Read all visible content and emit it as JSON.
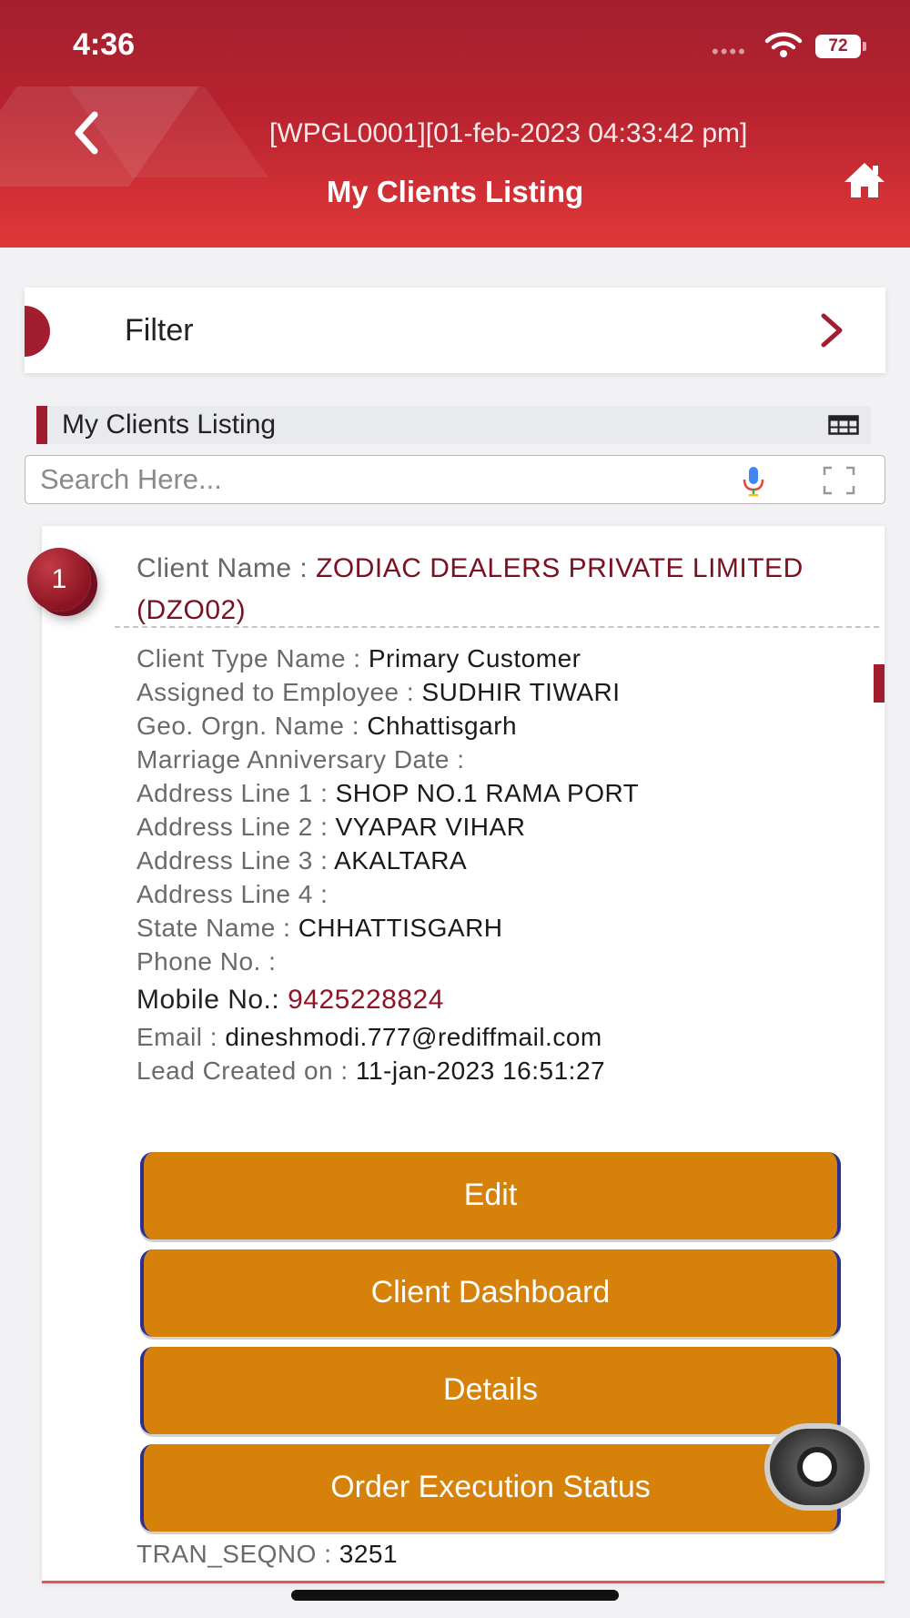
{
  "status_bar": {
    "time": "4:36",
    "battery": "72",
    "signal_dots": "••••"
  },
  "header": {
    "subtitle": "[WPGL0001][01-feb-2023 04:33:42 pm]",
    "title": "My Clients Listing",
    "back_icon": "chevron-left-icon",
    "home_icon": "home-icon"
  },
  "filter": {
    "label": "Filter"
  },
  "section": {
    "title": "My Clients Listing"
  },
  "search": {
    "placeholder": "Search Here..."
  },
  "client": {
    "index": "1",
    "name_label": "Client Name : ",
    "name_value": "ZODIAC DEALERS PRIVATE LIMITED (DZO02)",
    "fields": [
      {
        "label": "Client Type Name : ",
        "value": "Primary Customer"
      },
      {
        "label": "Assigned to Employee : ",
        "value": "SUDHIR TIWARI"
      },
      {
        "label": "Geo. Orgn. Name : ",
        "value": "Chhattisgarh"
      },
      {
        "label": "Marriage Anniversary Date :",
        "value": ""
      },
      {
        "label": "Address Line 1 : ",
        "value": "SHOP NO.1 RAMA PORT"
      },
      {
        "label": "Address Line 2 : ",
        "value": "VYAPAR VIHAR"
      },
      {
        "label": "Address Line 3 : ",
        "value": "AKALTARA"
      },
      {
        "label": "Address Line 4 :",
        "value": ""
      },
      {
        "label": "State Name : ",
        "value": "CHHATTISGARH"
      },
      {
        "label": "Phone No. :",
        "value": ""
      }
    ],
    "mobile": {
      "label": "Mobile No.: ",
      "value": "9425228824"
    },
    "email": {
      "label": "Email : ",
      "value": "dineshmodi.777@rediffmail.com"
    },
    "lead_created": {
      "label": "Lead Created on : ",
      "value": "11-jan-2023 16:51:27"
    },
    "buttons": [
      "Edit",
      "Client Dashboard",
      "Details",
      "Order Execution Status"
    ],
    "tran_seqno": {
      "label": "TRAN_SEQNO : ",
      "value": "3251"
    }
  },
  "colors": {
    "header": "#a31f2f",
    "accent": "#a01e2e",
    "button": "#d6810a",
    "button_border": "#2b2f8f"
  }
}
